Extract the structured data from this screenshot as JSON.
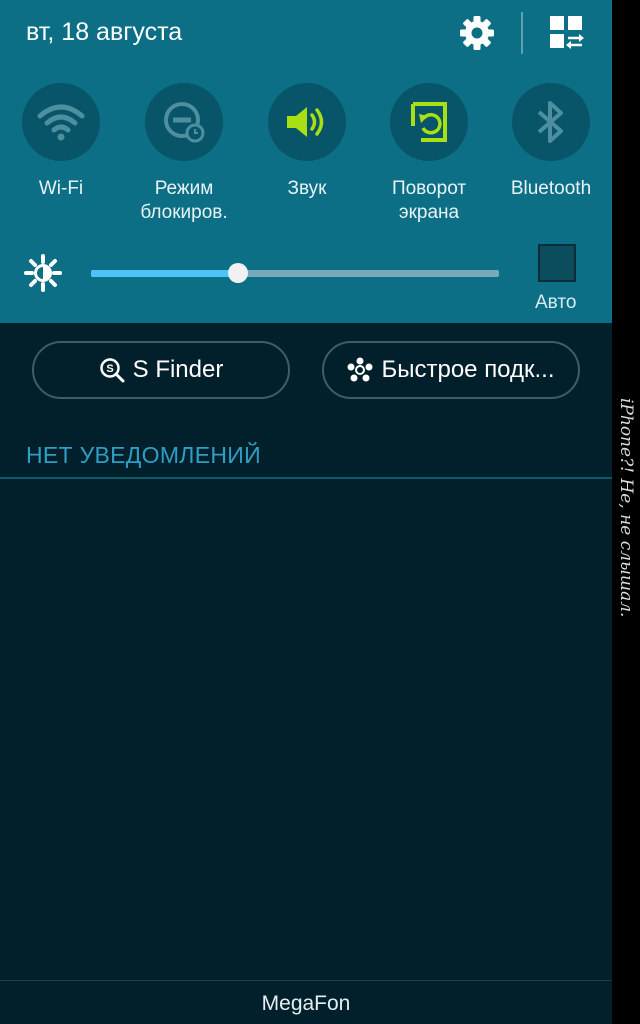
{
  "header": {
    "date": "вт, 18 августа",
    "settings_icon": "gear-icon",
    "edit_icon": "grid-icon"
  },
  "toggles": [
    {
      "label": "Wi-Fi",
      "icon": "wifi-icon",
      "active": false
    },
    {
      "label": "Режим\nблокиров.",
      "icon": "blocking-mode-icon",
      "active": false
    },
    {
      "label": "Звук",
      "icon": "speaker-icon",
      "active": true
    },
    {
      "label": "Поворот\nэкрана",
      "icon": "rotate-screen-icon",
      "active": true
    },
    {
      "label": "Bluetooth",
      "icon": "bluetooth-icon",
      "active": false
    }
  ],
  "brightness": {
    "level": 0.36,
    "auto_label": "Авто",
    "auto_checked": false
  },
  "buttons": {
    "s_finder": "S Finder",
    "quick_connect": "Быстрое подк..."
  },
  "notifications": {
    "empty_label": "НЕТ УВЕДОМЛЕНИЙ"
  },
  "footer": {
    "carrier": "MegaFon"
  },
  "watermark": "iPhone?! Не, не слышал.",
  "colors": {
    "header_bg": "#0c6f86",
    "panel_bg": "#01202c",
    "active_icon": "#a8e014",
    "inactive_icon": "#4d8e9f",
    "slider_fill": "#4fc3f7",
    "section_label": "#2d9fc2"
  }
}
